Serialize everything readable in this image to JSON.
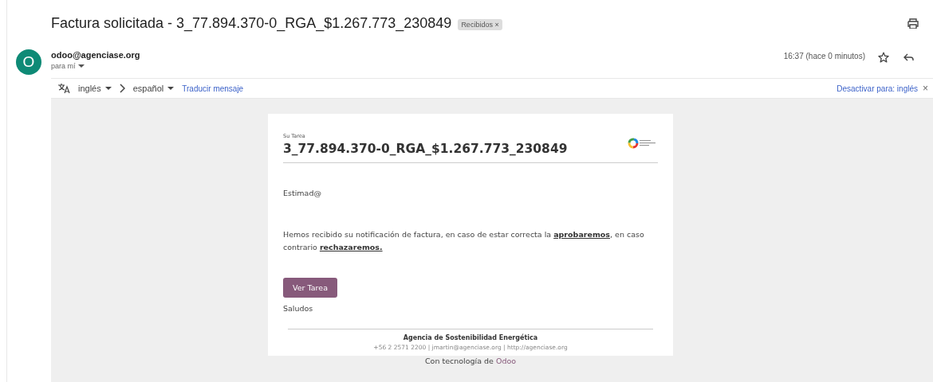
{
  "subject": "Factura solicitada - 3_77.894.370-0_RGA_$1.267.773_230849",
  "labels": [
    {
      "text": "Recibidos",
      "close": "×"
    }
  ],
  "sender": {
    "avatar_letter": "O",
    "email": "odoo@agenciase.org",
    "recipient": "para mí"
  },
  "time": "16:37 (hace 0 minutos)",
  "translate": {
    "from": "inglés",
    "to": "español",
    "action": "Traducir mensaje",
    "disable": "Desactivar para: inglés",
    "close": "×"
  },
  "message": {
    "eyebrow": "Su Tarea",
    "title": "3_77.894.370-0_RGA_$1.267.773_230849",
    "greeting": "Estimad@",
    "body": [
      {
        "kind": "text",
        "text": "Hemos recibido su notificación de factura, en caso de estar correcta la "
      },
      {
        "kind": "link",
        "text": "aprobaremos"
      },
      {
        "kind": "text",
        "text": ", en caso contrario "
      },
      {
        "kind": "link",
        "text": "rechazaremos."
      }
    ],
    "button": "Ver Tarea",
    "closing": "Saludos",
    "footer_name": "Agencia de Sostenibilidad Energética",
    "footer_contact": "+56 2 2571 2200 | jmartin@agenciase.org | http://agenciase.org"
  },
  "powered_by": {
    "text": "Con tecnología de",
    "link": "Odoo"
  }
}
